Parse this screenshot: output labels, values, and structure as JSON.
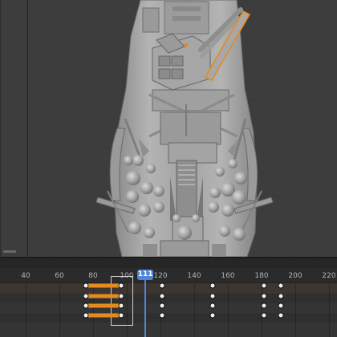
{
  "timeline": {
    "current_frame": "111",
    "ruler_labels": [
      "40",
      "60",
      "80",
      "100",
      "120",
      "140",
      "160",
      "180",
      "200",
      "220"
    ],
    "track_count": 4
  },
  "colors": {
    "viewport_background": "#3d3d3d",
    "model_grey": "#a8a8a8",
    "selection_outline": "#e58a1f",
    "keyframe_bar": "#e58a1f",
    "playhead": "#4f86d8"
  },
  "icons": [
    "viewport-corner-marker"
  ]
}
